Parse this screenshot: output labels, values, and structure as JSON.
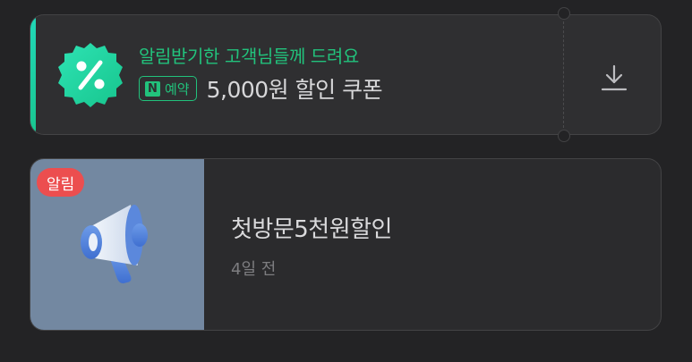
{
  "coupon": {
    "subtitle": "알림받기한 고객님들께 드려요",
    "badge_n": "N",
    "badge_label": "예약",
    "title": "5,000원 할인 쿠폰",
    "badge_icon": "percent-icon",
    "download_icon": "download-icon",
    "accent_color": "#22c27c"
  },
  "notice": {
    "tag": "알림",
    "title": "첫방문5천원할인",
    "time": "4일 전",
    "thumb_icon": "megaphone-icon",
    "tag_color": "#ec4e4f"
  }
}
